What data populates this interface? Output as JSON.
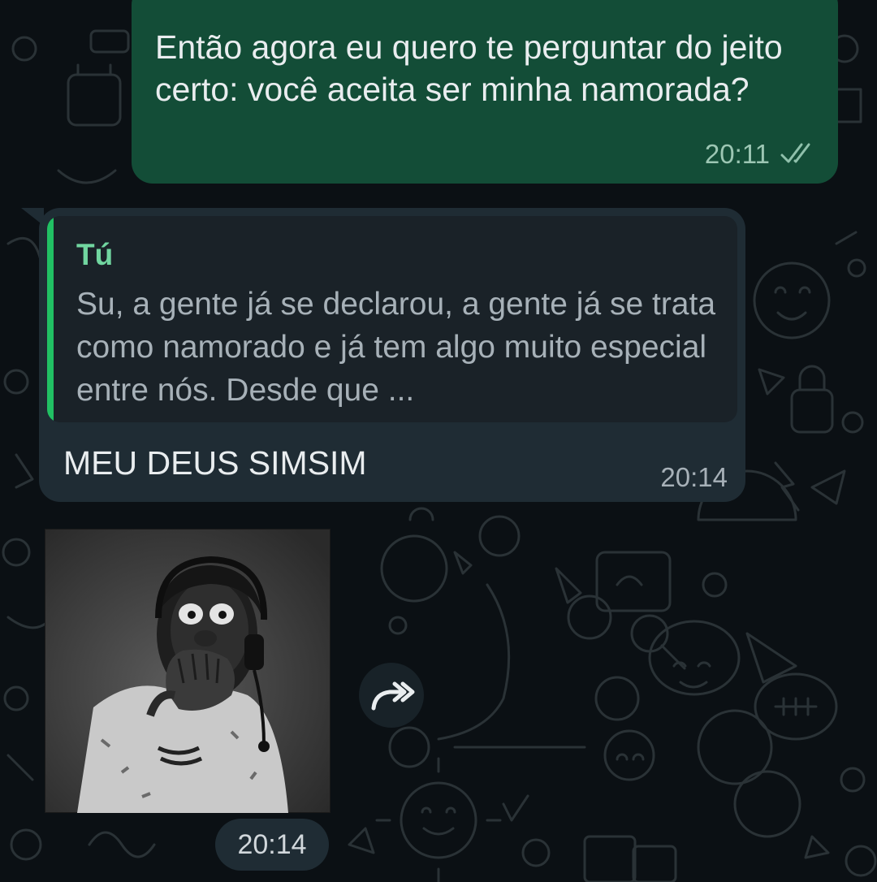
{
  "chat": {
    "messages": [
      {
        "direction": "outgoing",
        "text": "Então agora eu quero te perguntar do jeito certo: você aceita ser minha namorada?",
        "time": "20:11",
        "status": "read"
      },
      {
        "direction": "incoming",
        "quoted": {
          "author": "Tú",
          "text": "Su, a gente já se declarou, a gente já se trata como namorado e já tem algo muito especial entre nós. Desde que ..."
        },
        "text": "MEU DEUS SIMSIM",
        "time": "20:14"
      },
      {
        "direction": "incoming",
        "type": "sticker",
        "sticker_icon": "shocked-person-sticker",
        "time": "20:14"
      }
    ]
  },
  "colors": {
    "background": "#0b1014",
    "outgoing_bubble": "#134d37",
    "incoming_bubble": "#1f2c34",
    "quote_bar": "#21c063",
    "quote_author": "#71d6a0"
  },
  "icons": {
    "read_status": "double-check-icon",
    "forward": "forward-icon"
  }
}
